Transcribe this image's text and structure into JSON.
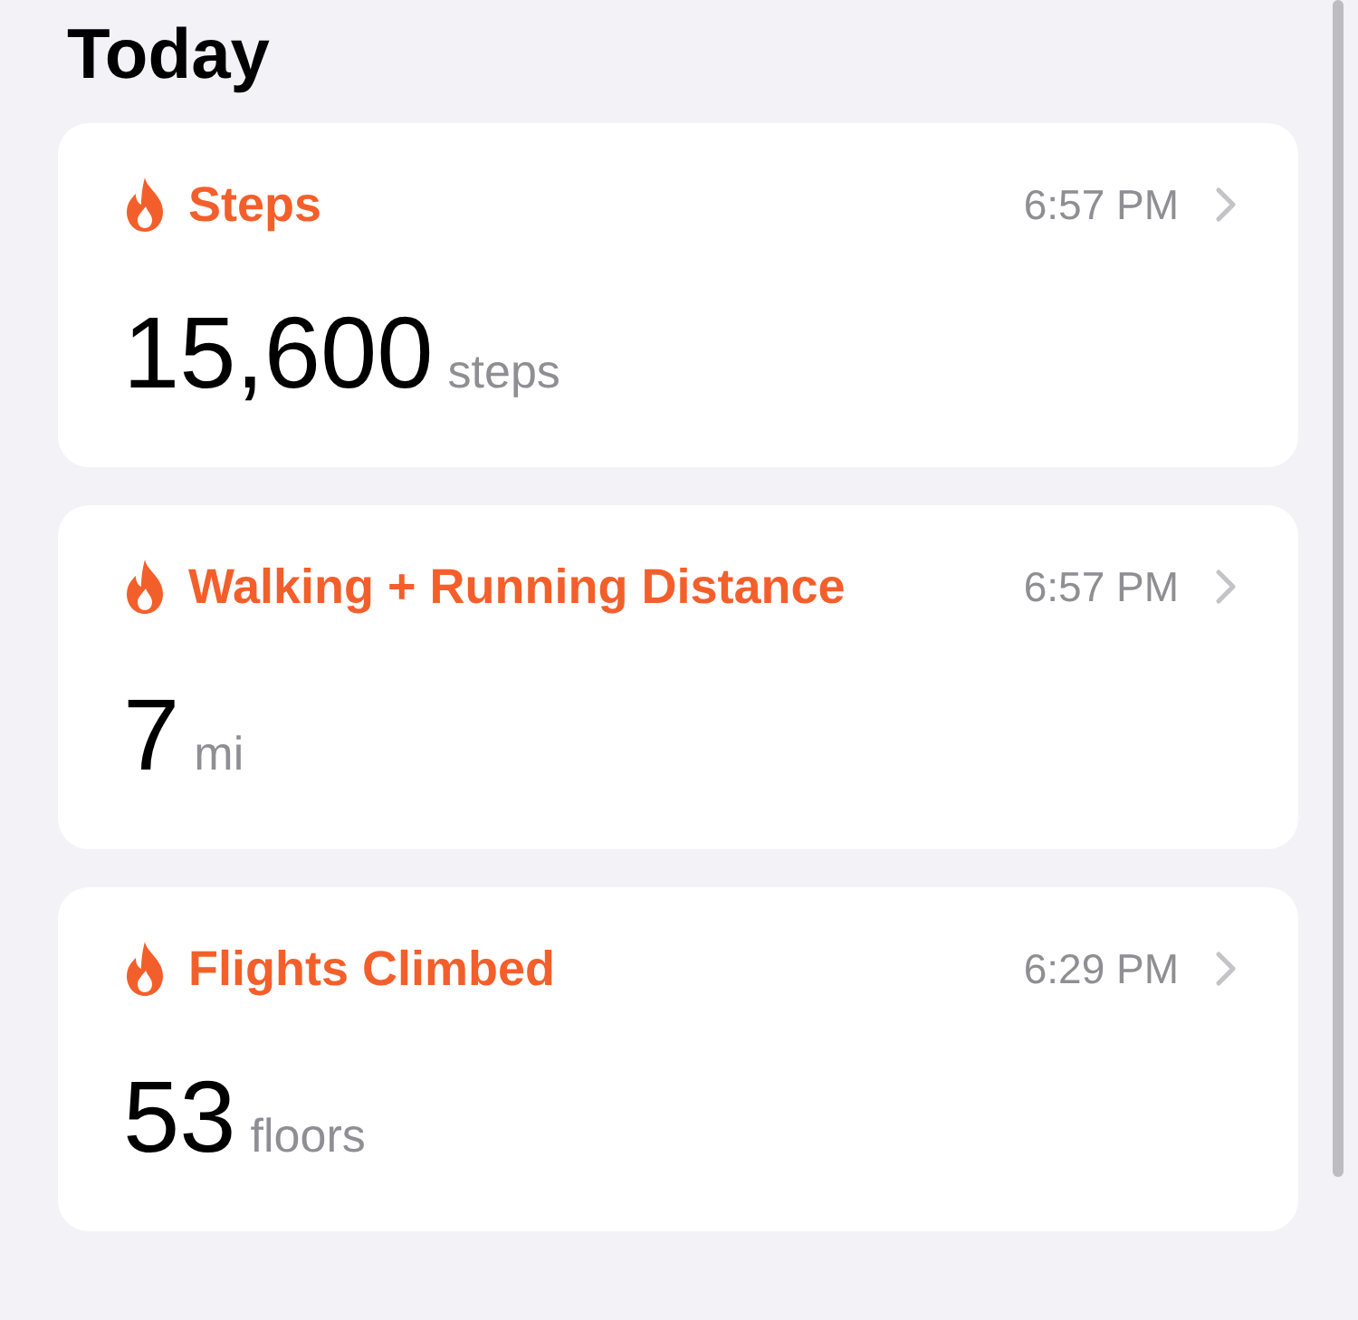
{
  "section_title": "Today",
  "cards": [
    {
      "title": "Steps",
      "time": "6:57 PM",
      "value": "15,600",
      "unit": "steps"
    },
    {
      "title": "Walking + Running Distance",
      "time": "6:57 PM",
      "value": "7",
      "unit": "mi"
    },
    {
      "title": "Flights Climbed",
      "time": "6:29 PM",
      "value": "53",
      "unit": "floors"
    }
  ]
}
